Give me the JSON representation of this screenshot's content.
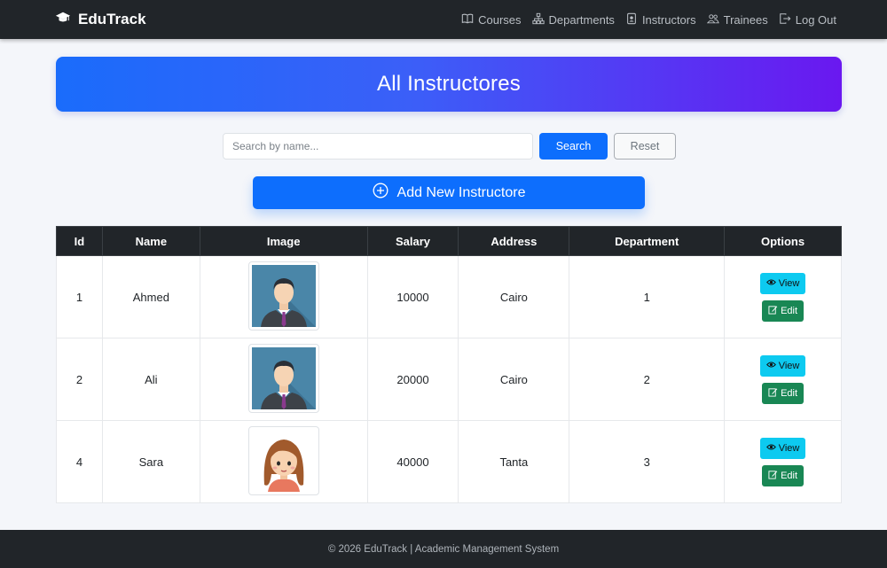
{
  "nav": {
    "brand": "EduTrack",
    "links": [
      {
        "label": "Courses",
        "icon": "book-icon"
      },
      {
        "label": "Departments",
        "icon": "diagram-icon"
      },
      {
        "label": "Instructors",
        "icon": "badge-icon"
      },
      {
        "label": "Trainees",
        "icon": "people-icon"
      },
      {
        "label": "Log Out",
        "icon": "logout-icon"
      }
    ]
  },
  "header": {
    "title": "All Instructores"
  },
  "search": {
    "placeholder": "Search by name...",
    "value": "",
    "search_label": "Search",
    "reset_label": "Reset"
  },
  "add_button": {
    "label": "Add New Instructore"
  },
  "table": {
    "headers": [
      "Id",
      "Name",
      "Image",
      "Salary",
      "Address",
      "Department",
      "Options"
    ],
    "rows": [
      {
        "id": "1",
        "name": "Ahmed",
        "avatar": "male-avatar",
        "salary": "10000",
        "address": "Cairo",
        "department": "1"
      },
      {
        "id": "2",
        "name": "Ali",
        "avatar": "male-avatar",
        "salary": "20000",
        "address": "Cairo",
        "department": "2"
      },
      {
        "id": "4",
        "name": "Sara",
        "avatar": "female-avatar",
        "salary": "40000",
        "address": "Tanta",
        "department": "3"
      }
    ],
    "view_label": "View",
    "edit_label": "Edit"
  },
  "footer": {
    "text": "© 2026 EduTrack | Academic Management System"
  },
  "colors": {
    "primary": "#0d6efd",
    "info": "#0dcaf0",
    "success": "#198754",
    "dark": "#212529",
    "gradient_end": "#6a18f0"
  }
}
